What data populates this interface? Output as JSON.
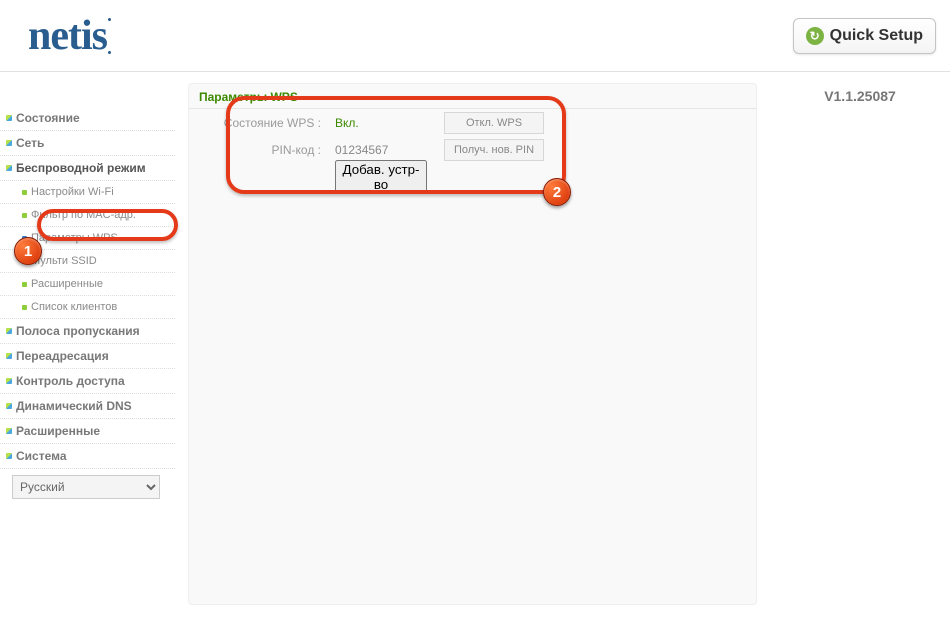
{
  "header": {
    "logo_text": "netis",
    "quick_setup": "Quick Setup"
  },
  "version": "V1.1.25087",
  "sidebar": {
    "items": [
      {
        "label": "Состояние"
      },
      {
        "label": "Сеть"
      },
      {
        "label": "Беспроводной режим",
        "expanded": true
      },
      {
        "label": "Настройки Wi-Fi",
        "child": true
      },
      {
        "label": "Фильтр по MAC-адр.",
        "child": true
      },
      {
        "label": "Параметры WPS",
        "child": true,
        "current": true
      },
      {
        "label": "Мульти SSID",
        "child": true
      },
      {
        "label": "Расширенные",
        "child": true
      },
      {
        "label": "Список клиентов",
        "child": true
      },
      {
        "label": "Полоса пропускания"
      },
      {
        "label": "Переадресация"
      },
      {
        "label": "Контроль доступа"
      },
      {
        "label": "Динамический DNS"
      },
      {
        "label": "Расширенные"
      },
      {
        "label": "Система"
      }
    ],
    "language": "Русский"
  },
  "content": {
    "title": "Параметры WPS",
    "rows": {
      "status_label": "Состояние WPS :",
      "status_value": "Вкл.",
      "disable_btn": "Откл. WPS",
      "pin_label": "PIN-код :",
      "pin_value": "01234567",
      "newpin_btn": "Получ. нов. PIN",
      "adddev_btn": "Добав. устр-во"
    }
  },
  "annotations": {
    "b1": "1",
    "b2": "2"
  }
}
